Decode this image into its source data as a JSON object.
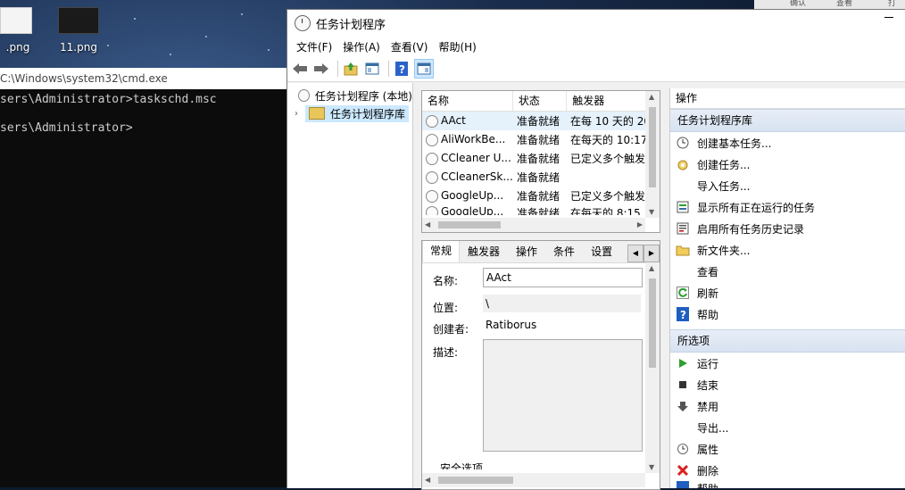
{
  "desktop": {
    "icons": [
      {
        "label": ".png"
      },
      {
        "label": "11.png"
      }
    ],
    "taskbar_fragments": [
      "确认",
      "查看",
      "打"
    ]
  },
  "cmd": {
    "title": "C:\\Windows\\system32\\cmd.exe",
    "line1": "sers\\Administrator>taskschd.msc",
    "line2": "sers\\Administrator>"
  },
  "mmc": {
    "title": "任务计划程序",
    "menu": [
      "文件(F)",
      "操作(A)",
      "查看(V)",
      "帮助(H)"
    ],
    "tree": {
      "root": "任务计划程序 (本地)",
      "child": "任务计划程序库"
    },
    "list": {
      "headers": [
        "名称",
        "状态",
        "触发器"
      ],
      "rows": [
        {
          "name": "AAct",
          "status": "准备就绪",
          "trigger": "在每 10 天的 20"
        },
        {
          "name": "AliWorkBe...",
          "status": "准备就绪",
          "trigger": "在每天的 10:17"
        },
        {
          "name": "CCleaner U...",
          "status": "准备就绪",
          "trigger": "已定义多个触发"
        },
        {
          "name": "CCleanerSk...",
          "status": "准备就绪",
          "trigger": ""
        },
        {
          "name": "GoogleUp...",
          "status": "准备就绪",
          "trigger": "已定义多个触发"
        },
        {
          "name": "GoogleUp...",
          "status": "准备就绪",
          "trigger": "在每天的 8:15"
        }
      ]
    },
    "detail": {
      "tabs": [
        "常规",
        "触发器",
        "操作",
        "条件",
        "设置"
      ],
      "labels": {
        "name": "名称:",
        "location": "位置:",
        "author": "创建者:",
        "description": "描述:",
        "security": "安全选项"
      },
      "values": {
        "name": "AAct",
        "location": "\\",
        "author": "Ratiborus",
        "description": ""
      }
    },
    "actions": {
      "header": "操作",
      "section1": "任务计划程序库",
      "items1": [
        {
          "label": "创建基本任务...",
          "icon": "calendar-clock-icon"
        },
        {
          "label": "创建任务...",
          "icon": "task-icon"
        },
        {
          "label": "导入任务...",
          "icon": "none"
        },
        {
          "label": "显示所有正在运行的任务",
          "icon": "running-tasks-icon"
        },
        {
          "label": "启用所有任务历史记录",
          "icon": "history-icon"
        },
        {
          "label": "新文件夹...",
          "icon": "folder-icon"
        },
        {
          "label": "查看",
          "icon": "none"
        },
        {
          "label": "刷新",
          "icon": "refresh-icon"
        },
        {
          "label": "帮助",
          "icon": "help-icon"
        }
      ],
      "section2": "所选项",
      "items2": [
        {
          "label": "运行",
          "icon": "run-icon"
        },
        {
          "label": "结束",
          "icon": "stop-icon"
        },
        {
          "label": "禁用",
          "icon": "disable-icon"
        },
        {
          "label": "导出...",
          "icon": "none"
        },
        {
          "label": "属性",
          "icon": "properties-icon"
        },
        {
          "label": "删除",
          "icon": "delete-icon"
        },
        {
          "label": "帮助",
          "icon": "help-icon"
        }
      ]
    },
    "colors": {
      "accent_section": "#d7e2f1",
      "selection": "#cce8ff",
      "run_green": "#2e9e2e",
      "delete_red": "#d92020",
      "help_blue": "#1f5fbf"
    }
  }
}
